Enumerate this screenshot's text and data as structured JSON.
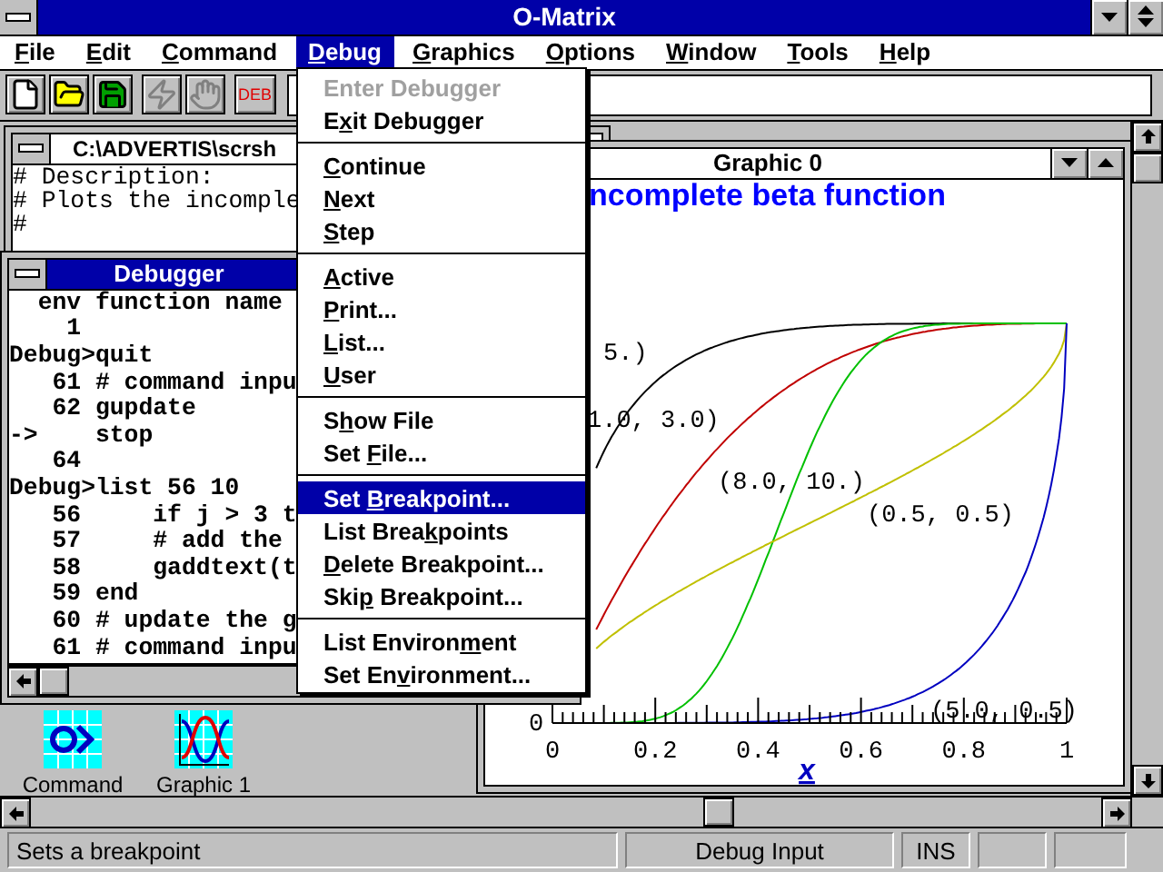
{
  "window": {
    "title": "O-Matrix"
  },
  "menu_bar": [
    {
      "label": {
        "key": "F",
        "after": "ile"
      },
      "selected": false
    },
    {
      "label": {
        "key": "E",
        "after": "dit"
      },
      "selected": false
    },
    {
      "label": {
        "key": "C",
        "after": "ommand"
      },
      "selected": false
    },
    {
      "label": {
        "key": "D",
        "after": "ebug"
      },
      "selected": true
    },
    {
      "label": {
        "key": "G",
        "after": "raphics"
      },
      "selected": false
    },
    {
      "label": {
        "key": "O",
        "after": "ptions"
      },
      "selected": false
    },
    {
      "label": {
        "key": "W",
        "after": "indow"
      },
      "selected": false
    },
    {
      "label": {
        "key": "T",
        "after": "ools"
      },
      "selected": false
    },
    {
      "label": {
        "key": "H",
        "after": "elp"
      },
      "selected": false
    }
  ],
  "toolbar": [
    {
      "kind": "new",
      "disabled": false
    },
    {
      "kind": "open",
      "disabled": false
    },
    {
      "kind": "save",
      "disabled": false
    },
    {
      "kind": "lightning",
      "disabled": true
    },
    {
      "kind": "hand",
      "disabled": true
    },
    {
      "kind": "text",
      "label": "DEB",
      "disabled": false
    }
  ],
  "file_window": {
    "title": "C:\\ADVERTIS\\scrsh",
    "lines": [
      "# Description:",
      "# Plots the incomple",
      "#"
    ]
  },
  "debugger": {
    "title": "Debugger",
    "lines": [
      "  env function name",
      "    1",
      "Debug>quit",
      "   61 # command inpu",
      "   62 gupdate",
      "->    stop",
      "   64",
      "Debug>list 56 10",
      "   56     if j > 3 t",
      "   57     # add the",
      "   58     gaddtext(t",
      "   59 end",
      "   60 # update the g",
      "   61 # command inpu"
    ]
  },
  "graphic_window": {
    "title": "Graphic 0",
    "chart_title": "ncomplete beta function",
    "curves": [
      {
        "label": "5.)",
        "color": "#000000"
      },
      {
        "label": "1.0, 3.0)",
        "color": "#c00000"
      },
      {
        "label": "(8.0, 10.)",
        "color": "#00c000"
      },
      {
        "label": "(0.5, 0.5)",
        "color": "#c0c000"
      },
      {
        "label": "(5.0, 0.5)",
        "color": "#0000c0"
      }
    ],
    "y_tick": "0",
    "x_ticks": [
      "0",
      "0.2",
      "0.4",
      "0.6",
      "0.8",
      "1"
    ],
    "x_label": "x"
  },
  "desktop_icons": [
    {
      "kind": "command",
      "label": "Command"
    },
    {
      "kind": "graphic",
      "label": "Graphic 1"
    }
  ],
  "debug_menu": [
    {
      "kind": "item",
      "label": {
        "before": "Enter Debugger"
      },
      "disabled": true,
      "selected": false
    },
    {
      "kind": "item",
      "label": {
        "before": "E",
        "key": "x",
        "after": "it Debugger"
      },
      "disabled": false,
      "selected": false
    },
    {
      "kind": "separator"
    },
    {
      "kind": "item",
      "label": {
        "key": "C",
        "after": "ontinue"
      },
      "disabled": false,
      "selected": false
    },
    {
      "kind": "item",
      "label": {
        "key": "N",
        "after": "ext"
      },
      "disabled": false,
      "selected": false
    },
    {
      "kind": "item",
      "label": {
        "key": "S",
        "after": "tep"
      },
      "disabled": false,
      "selected": false
    },
    {
      "kind": "separator"
    },
    {
      "kind": "item",
      "label": {
        "key": "A",
        "after": "ctive"
      },
      "disabled": false,
      "selected": false
    },
    {
      "kind": "item",
      "label": {
        "key": "P",
        "after": "rint..."
      },
      "disabled": false,
      "selected": false
    },
    {
      "kind": "item",
      "label": {
        "key": "L",
        "after": "ist..."
      },
      "disabled": false,
      "selected": false
    },
    {
      "kind": "item",
      "label": {
        "key": "U",
        "after": "ser"
      },
      "disabled": false,
      "selected": false
    },
    {
      "kind": "separator"
    },
    {
      "kind": "item",
      "label": {
        "before": "S",
        "key": "h",
        "after": "ow File"
      },
      "disabled": false,
      "selected": false
    },
    {
      "kind": "item",
      "label": {
        "before": "Set ",
        "key": "F",
        "after": "ile..."
      },
      "disabled": false,
      "selected": false
    },
    {
      "kind": "separator"
    },
    {
      "kind": "item",
      "label": {
        "before": "Set ",
        "key": "B",
        "after": "reakpoint..."
      },
      "disabled": false,
      "selected": true
    },
    {
      "kind": "item",
      "label": {
        "before": "List Brea",
        "key": "k",
        "after": "points"
      },
      "disabled": false,
      "selected": false
    },
    {
      "kind": "item",
      "label": {
        "key": "D",
        "after": "elete Breakpoint..."
      },
      "disabled": false,
      "selected": false
    },
    {
      "kind": "item",
      "label": {
        "before": "Ski",
        "key": "p",
        "after": " Breakpoint..."
      },
      "disabled": false,
      "selected": false
    },
    {
      "kind": "separator"
    },
    {
      "kind": "item",
      "label": {
        "before": "List Environ",
        "key": "m",
        "after": "ent"
      },
      "disabled": false,
      "selected": false
    },
    {
      "kind": "item",
      "label": {
        "before": "Set En",
        "key": "v",
        "after": "ironment..."
      },
      "disabled": false,
      "selected": false
    }
  ],
  "status_bar": {
    "message": "Sets a breakpoint",
    "mode": "Debug Input",
    "insert": "INS"
  }
}
